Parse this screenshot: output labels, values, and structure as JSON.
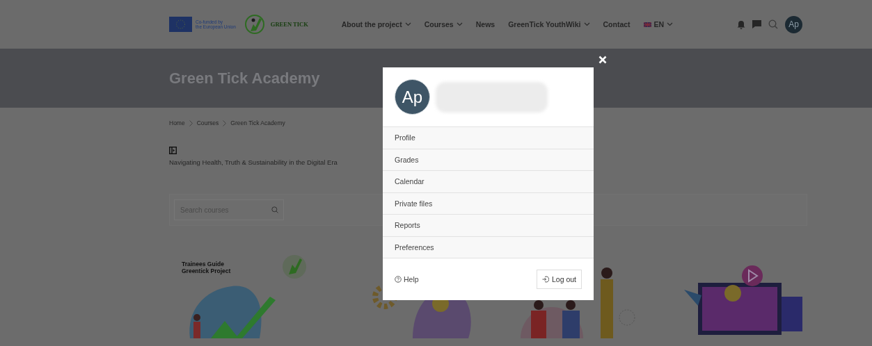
{
  "header": {
    "eu_lines": [
      "Co-funded by",
      "the European Union"
    ],
    "brand": "GREEN TICK",
    "nav": [
      {
        "label": "About the project",
        "has_menu": true
      },
      {
        "label": "Courses",
        "has_menu": true
      },
      {
        "label": "News",
        "has_menu": false
      },
      {
        "label": "GreenTick YouthWiki",
        "has_menu": true
      },
      {
        "label": "Contact",
        "has_menu": false
      }
    ],
    "language": "EN",
    "avatar": "Ap"
  },
  "hero": {
    "title": "Green Tick Academy"
  },
  "breadcrumb": [
    "Home",
    "Courses",
    "Green Tick Academy"
  ],
  "course_summary": "Navigating Health, Truth & Sustainability in the Digital Era",
  "search": {
    "placeholder": "Search courses"
  },
  "courses": [
    {
      "kind": "guide",
      "lines": [
        "Trainees Guide",
        "Greentick Project"
      ]
    },
    {
      "kind": "gears"
    },
    {
      "kind": "people"
    },
    {
      "kind": "video"
    }
  ],
  "user_menu": {
    "avatar": "Ap",
    "items": [
      {
        "label": "Profile"
      },
      {
        "label": "Grades"
      },
      {
        "label": "Calendar"
      },
      {
        "label": "Private files"
      },
      {
        "label": "Reports"
      },
      {
        "label": "Preferences"
      }
    ],
    "help": "Help",
    "logout": "Log out"
  }
}
